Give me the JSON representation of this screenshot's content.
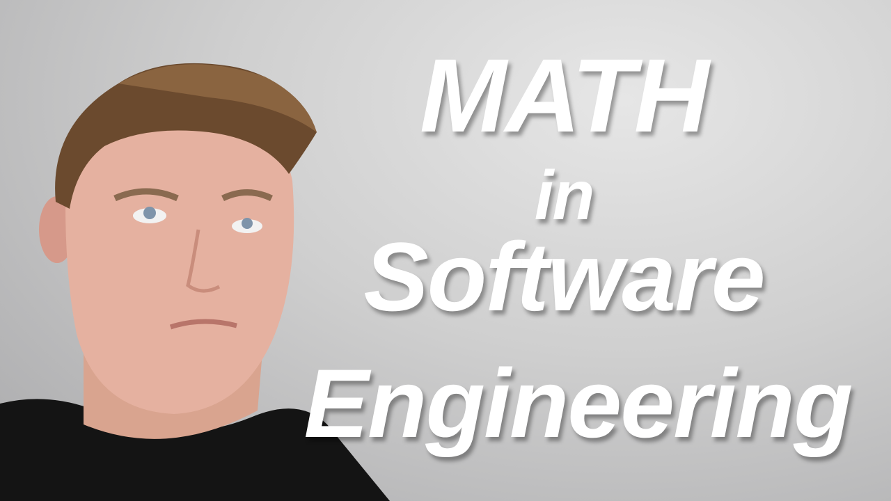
{
  "title": {
    "line1": "MATH",
    "line2": "in",
    "line3": "Software",
    "line4": "Engineering"
  },
  "colors": {
    "text": "#ffffff",
    "background": "#cfcfcf",
    "shirt": "#111111"
  }
}
